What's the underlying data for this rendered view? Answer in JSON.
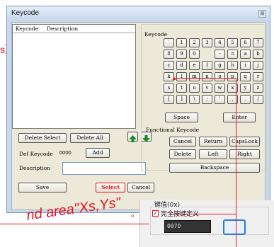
{
  "window": {
    "title": "Keycode",
    "close_glyph": "⊠"
  },
  "list": {
    "col_keycode": "Keycode",
    "col_description": "Description"
  },
  "buttons": {
    "delete_select": "Delete Select",
    "delete_all": "Delete All",
    "add": "Add",
    "save": "Save",
    "select": "Select",
    "cancel": "Cancel"
  },
  "form": {
    "def_keycode_label": "Def Keycode",
    "def_keycode_value": "0000",
    "description_label": "Description",
    "description_value": ""
  },
  "keycode": {
    "label": "Keycode",
    "rows": [
      [
        "`",
        "1",
        "2",
        "3",
        "4",
        "5",
        "6",
        "7"
      ],
      [
        "8",
        "9",
        "0",
        "-",
        "=",
        "a",
        "b"
      ],
      [
        "c",
        "d",
        "e",
        "f",
        "g",
        "h",
        "i",
        "j"
      ],
      [
        "k",
        "l",
        "m",
        "n",
        "o",
        "p",
        "q",
        "r"
      ],
      [
        "s",
        "t",
        "u",
        "v",
        "w",
        "x",
        "y",
        "z"
      ],
      [
        "[",
        "]",
        "\\",
        ";",
        "'",
        ",",
        ".",
        "/"
      ]
    ],
    "space": "Space",
    "enter": "Enter"
  },
  "functional": {
    "label": "Functional Keycode",
    "cancel": "Cancel",
    "return": "Return",
    "capslock": "CapsLock",
    "delete": "Delete",
    "left": "Left",
    "right": "Right",
    "backspace": "Backspace"
  },
  "overlay": {
    "left_text": "s）",
    "left_dot": "。",
    "bottom_text": "nd area\"Xs,Ys\"",
    "bottom_dot": "。",
    "accent": "#e8141e"
  },
  "panel2": {
    "label": "键值(0x)",
    "checkbox_label": "完全按键定义",
    "checked": true,
    "value": "0070"
  }
}
